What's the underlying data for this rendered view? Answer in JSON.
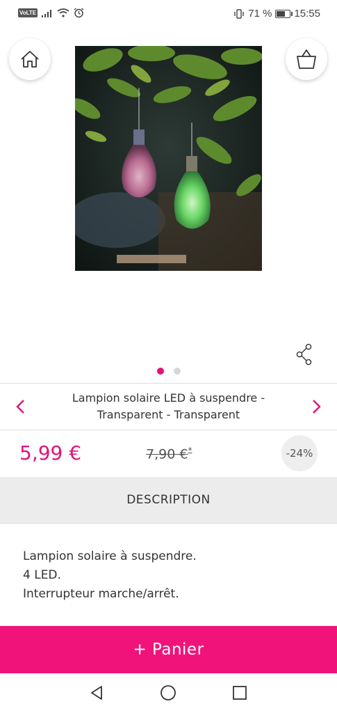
{
  "status_bar": {
    "volte": "VoLTE",
    "battery_percent": "71 %",
    "battery_level": 0.71,
    "time": "15:55"
  },
  "top_actions": {
    "home_icon": "home-icon",
    "cart_icon": "shopping-bag-icon"
  },
  "gallery": {
    "image_count": 2,
    "active_index": 0
  },
  "product": {
    "title_line1": "Lampion solaire LED à suspendre -",
    "title_line2": "Transparent - Transparent",
    "price": "5,99 €",
    "old_price": "7,90 €",
    "old_price_mark": "*",
    "discount": "-24%"
  },
  "description": {
    "header": "DESCRIPTION",
    "lines": [
      "Lampion solaire à suspendre.",
      "4 LED.",
      "Interrupteur marche/arrêt."
    ]
  },
  "cart_button": {
    "label": "+ Panier"
  },
  "colors": {
    "accent": "#e4127a",
    "cart_button": "#f0147a"
  }
}
